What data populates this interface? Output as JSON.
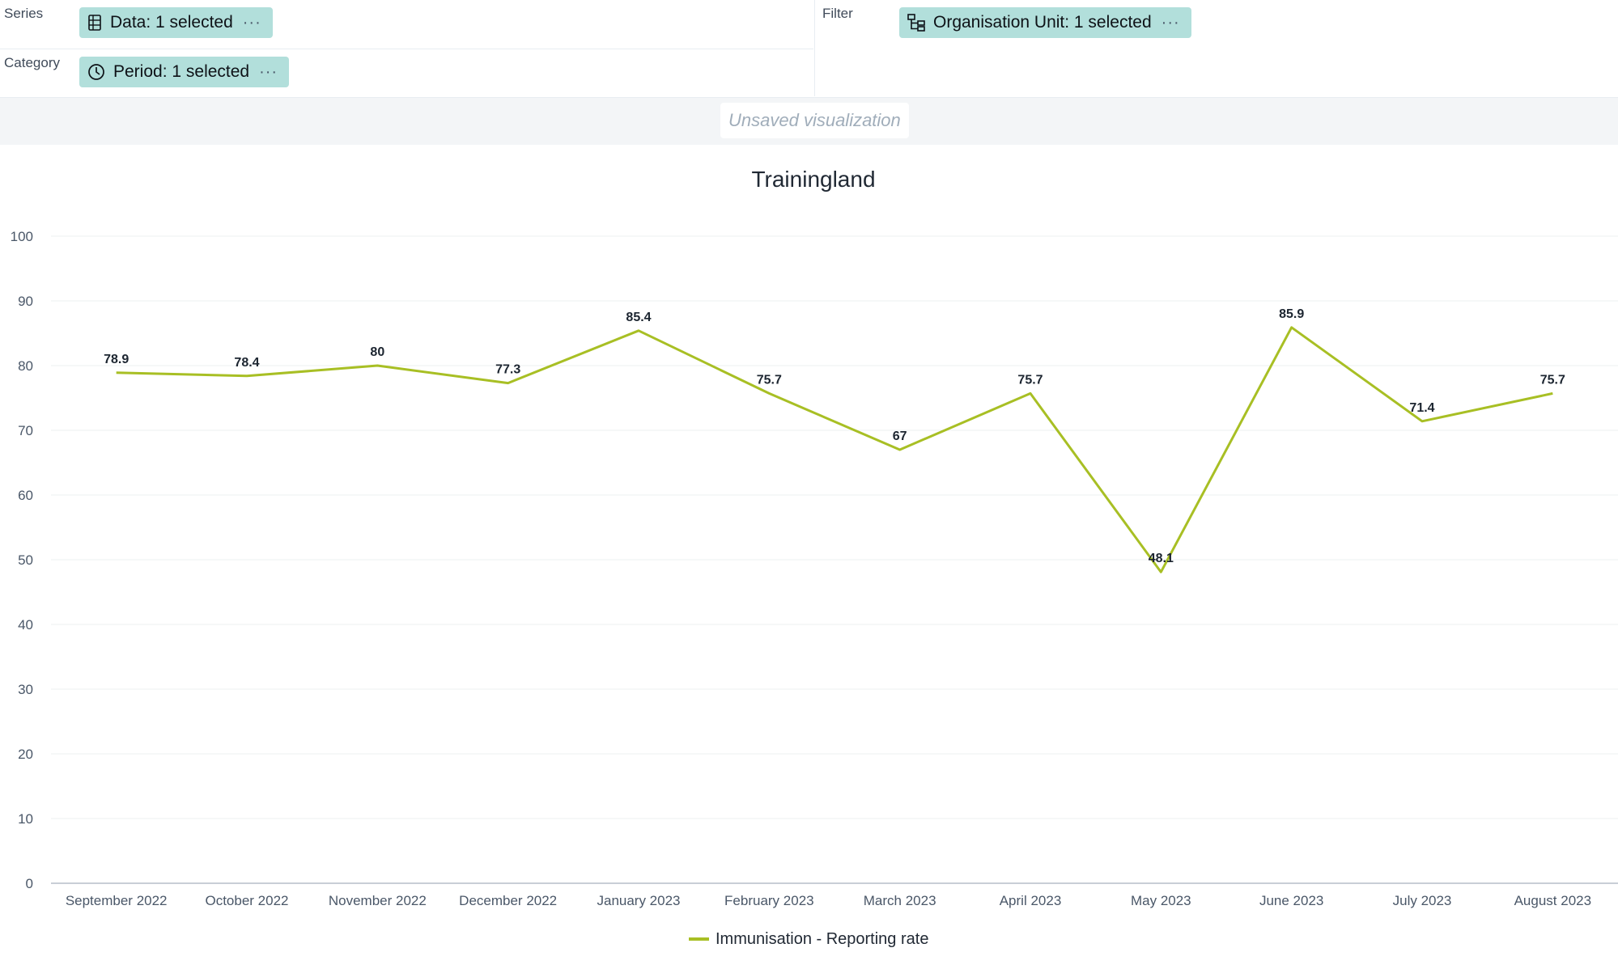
{
  "layout": {
    "series_label": "Series",
    "category_label": "Category",
    "filter_label": "Filter",
    "data_chip": "Data: 1 selected",
    "period_chip": "Period: 1 selected",
    "orgunit_chip": "Organisation Unit: 1 selected",
    "more_glyph": "···"
  },
  "title_bar": {
    "label": "Unsaved visualization"
  },
  "colors": {
    "chip_bg": "#b2dfdb",
    "series_line": "#a8bf24",
    "grid": "#eef0f2"
  },
  "chart_data": {
    "type": "line",
    "title": "Trainingland",
    "xlabel": "",
    "ylabel": "",
    "ylim": [
      0,
      100
    ],
    "yticks": [
      0,
      10,
      20,
      30,
      40,
      50,
      60,
      70,
      80,
      90,
      100
    ],
    "categories": [
      "September 2022",
      "October 2022",
      "November 2022",
      "December 2022",
      "January 2023",
      "February 2023",
      "March 2023",
      "April 2023",
      "May 2023",
      "June 2023",
      "July 2023",
      "August 2023"
    ],
    "series": [
      {
        "name": "Immunisation - Reporting rate",
        "values": [
          78.9,
          78.4,
          80,
          77.3,
          85.4,
          75.7,
          67,
          75.7,
          48.1,
          85.9,
          71.4,
          75.7
        ]
      }
    ],
    "grid": true,
    "legend": "bottom-center"
  }
}
